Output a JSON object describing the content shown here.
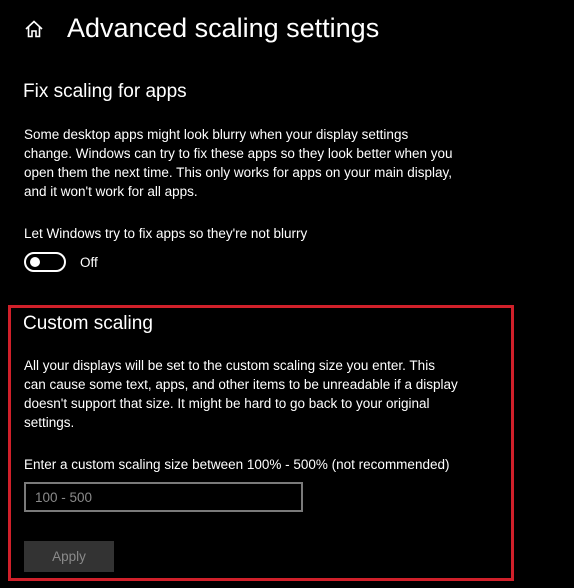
{
  "header": {
    "icon": "home-icon",
    "title": "Advanced scaling settings"
  },
  "fix_scaling": {
    "title": "Fix scaling for apps",
    "description_lines": [
      "Some desktop apps might look blurry when your display settings",
      "change. Windows can try to fix these apps so they look better when you",
      "open them the next time. This only works for apps on your main display,",
      "and it won't work for all apps."
    ],
    "toggle_label": "Let Windows try to fix apps so they're not blurry",
    "toggle_state": "Off",
    "toggle_on": false
  },
  "custom_scaling": {
    "title": "Custom scaling",
    "description_lines": [
      "All your displays will be set to the custom scaling size you enter. This",
      "can cause some text, apps, and other items to be unreadable if a display",
      "doesn't support that size. It might be hard to go back to your original",
      "settings."
    ],
    "input_label": "Enter a custom scaling size between 100% - 500% (not recommended)",
    "input_value": "",
    "input_placeholder": "100 - 500",
    "apply_label": "Apply",
    "apply_enabled": false
  },
  "colors": {
    "background": "#000000",
    "text": "#ffffff",
    "highlight_border": "#d0202a",
    "disabled_button_bg": "#333333",
    "disabled_text": "#8a8a8a",
    "input_border": "#7a7a7a"
  }
}
